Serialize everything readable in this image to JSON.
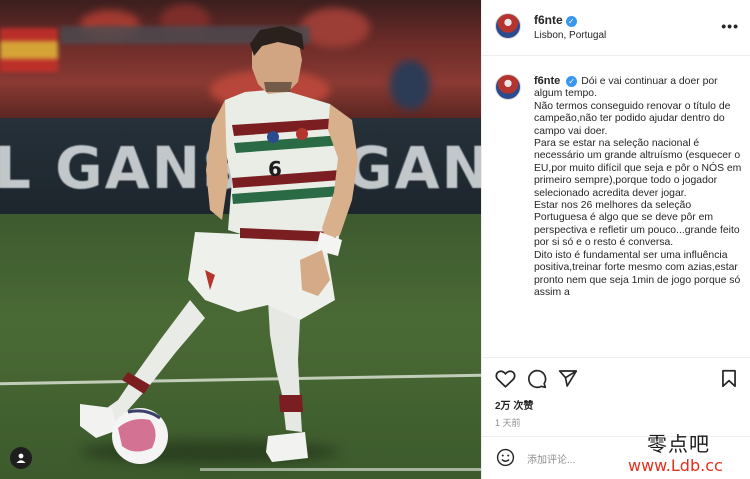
{
  "post": {
    "username": "f6nte",
    "location": "Lisbon, Portugal",
    "more_label": "•••",
    "photo": {
      "shirt_number": "6",
      "ad_text_left": "L GANS",
      "ad_text_right": "GANS"
    },
    "caption_lines": [
      "Dói e vai continuar a doer por algum tempo.",
      "Não termos conseguido renovar o título de campeão,não ter podido ajudar dentro do campo vai doer.",
      "Para se estar na seleção nacional é necessário um grande altruísmo (esquecer o EU,por muito difícil que seja e pôr o NÓS em primeiro sempre),porque todo o jogador selecionado acredita dever jogar.",
      "Estar nos 26 melhores da seleção Portuguesa é algo que se deve pôr em perspectiva e refletir um pouco...grande feito por si só e o resto é conversa.",
      "Dito isto é fundamental ser uma influência positiva,treinar forte mesmo com azias,estar pronto nem que seja 1min de jogo porque só assim a"
    ],
    "likes": "2万 次赞",
    "time": "1 天前",
    "comment_placeholder": "添加评论..."
  },
  "icons": {
    "verified": "verified-badge-icon",
    "like": "heart-icon",
    "comment": "comment-icon",
    "share": "send-icon",
    "save": "bookmark-icon",
    "emoji": "emoji-icon",
    "profile": "user-tag-icon"
  },
  "watermark": {
    "chinese": "零点吧",
    "url": "www.Ldb.cc"
  },
  "colors": {
    "verified": "#3897f0",
    "text": "#262626",
    "muted": "#8e8e8e",
    "watermark_url": "#e2301c"
  }
}
